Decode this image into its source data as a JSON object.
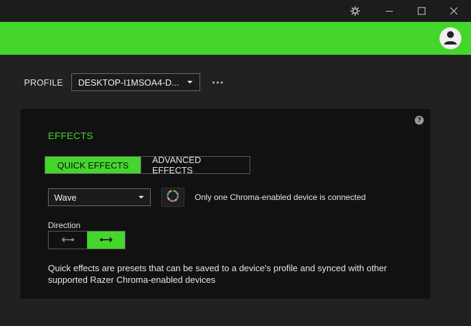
{
  "window": {
    "settings_icon": "gear-icon",
    "minimize_icon": "minimize-icon",
    "maximize_icon": "maximize-icon",
    "close_icon": "close-icon"
  },
  "banner": {
    "accent": "#44d62c",
    "avatar_icon": "user-avatar-icon"
  },
  "profile": {
    "label": "PROFILE",
    "selected": "DESKTOP-I1MSOA4-D...",
    "more_icon": "more-horizontal-icon"
  },
  "effects": {
    "title": "EFFECTS",
    "help_icon": "help-icon",
    "help_glyph": "?",
    "tabs": [
      {
        "label": "QUICK EFFECTS",
        "active": true
      },
      {
        "label": "ADVANCED EFFECTS",
        "active": false
      }
    ],
    "effect_selected": "Wave",
    "chroma_icon": "chroma-wheel-icon",
    "chroma_note": "Only one Chroma-enabled device is connected",
    "direction_label": "Direction",
    "direction_options": [
      {
        "icon": "arrow-left-icon",
        "active": false
      },
      {
        "icon": "arrow-right-icon",
        "active": true
      }
    ],
    "description": "Quick effects are presets that can be saved to a device's profile and synced with other supported Razer Chroma-enabled devices"
  }
}
